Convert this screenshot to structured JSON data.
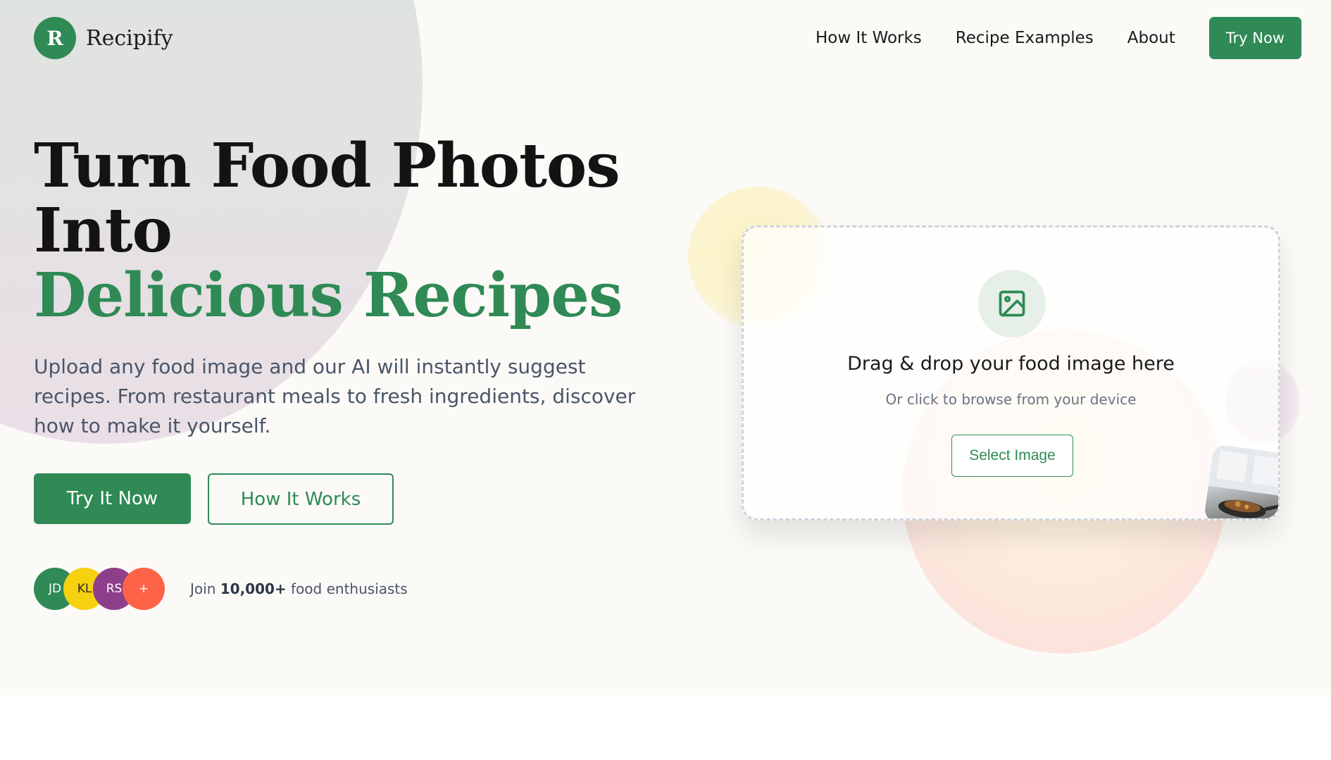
{
  "brand": {
    "mark": "R",
    "name": "Recipify",
    "accent_color": "#2f8a55"
  },
  "nav": {
    "links": [
      "How It Works",
      "Recipe Examples",
      "About"
    ],
    "cta": "Try Now"
  },
  "hero": {
    "headline_line1": "Turn Food Photos",
    "headline_line2": "Into",
    "headline_accent": "Delicious Recipes",
    "subtitle": "Upload any food image and our AI will instantly suggest recipes. From restaurant meals to fresh ingredients, discover how to make it yourself.",
    "primary_button": "Try It Now",
    "secondary_button": "How It Works"
  },
  "social_proof": {
    "avatars": [
      {
        "initials": "JD",
        "color": "#2f8a55",
        "text_color": "#ffffff"
      },
      {
        "initials": "KL",
        "color": "#f5d10f",
        "text_color": "#2d2d2d"
      },
      {
        "initials": "RS",
        "color": "#8e3f8a",
        "text_color": "#ffffff"
      },
      {
        "initials": "+",
        "color": "#ff6347",
        "text_color": "#ffffff"
      }
    ],
    "text_prefix": "Join",
    "text_count": "10,000+",
    "text_suffix": "food enthusiasts"
  },
  "upload": {
    "icon": "image-icon",
    "title": "Drag & drop your food image here",
    "subtitle": "Or click to browse from your device",
    "button": "Select Image",
    "thumbnail": "food-photo"
  }
}
